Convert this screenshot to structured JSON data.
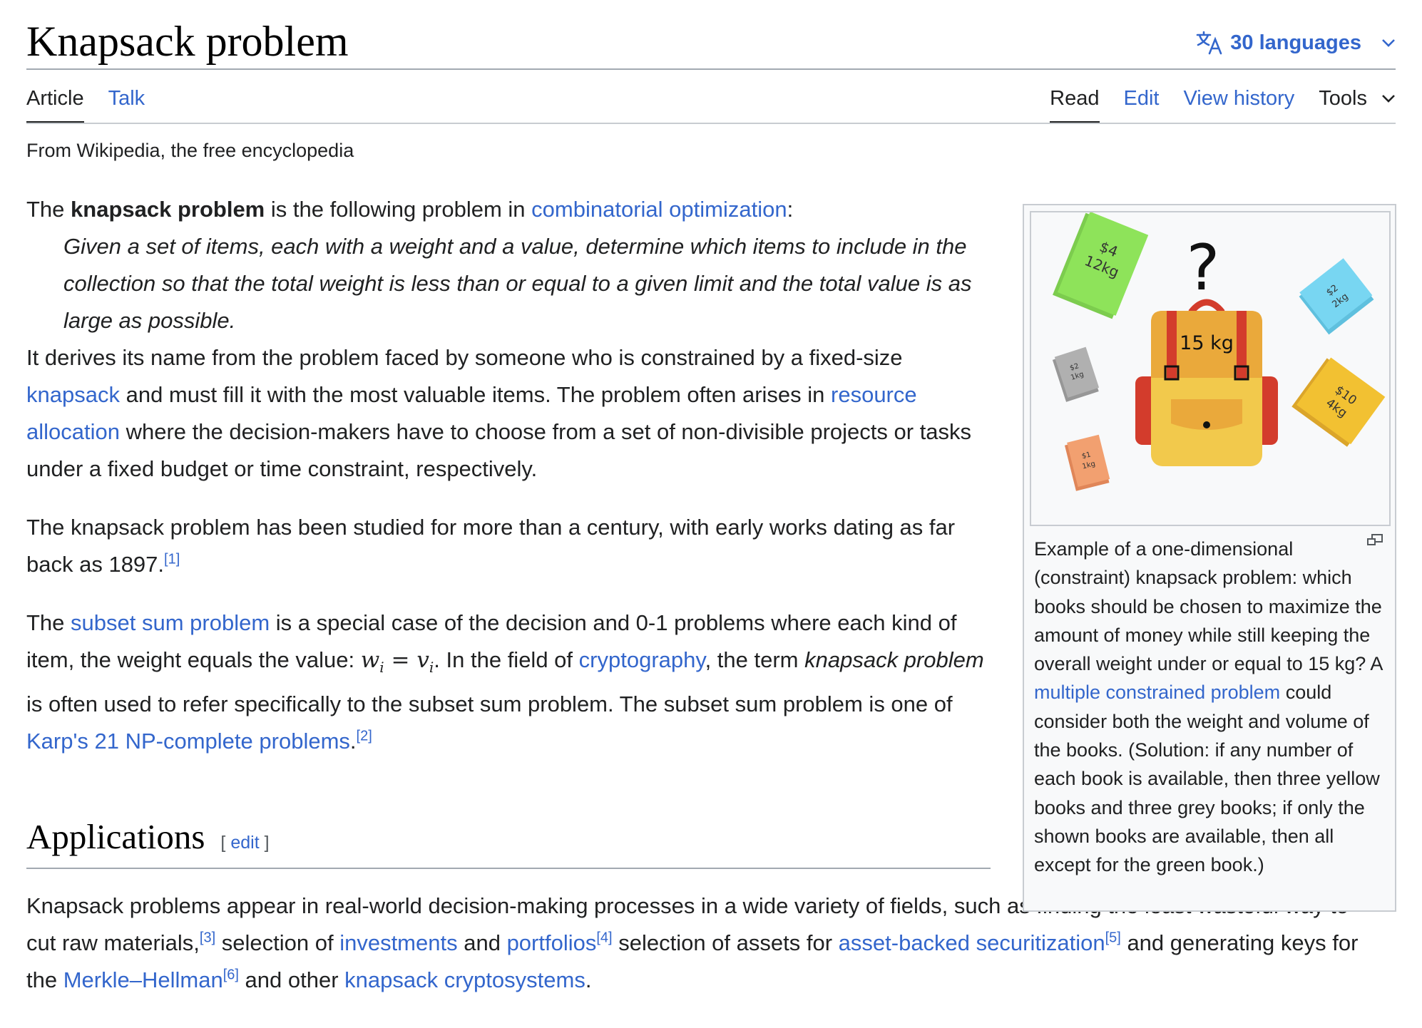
{
  "page": {
    "title": "Knapsack problem",
    "languages_label": "30 languages",
    "tagline": "From Wikipedia, the free encyclopedia"
  },
  "tabs_left": [
    {
      "label": "Article",
      "selected": true
    },
    {
      "label": "Talk",
      "selected": false
    }
  ],
  "tabs_right": [
    {
      "label": "Read",
      "selected": true
    },
    {
      "label": "Edit",
      "selected": false
    },
    {
      "label": "View history",
      "selected": false
    }
  ],
  "tools_label": "Tools",
  "intro": {
    "p1_before": "The ",
    "p1_bold": "knapsack problem",
    "p1_mid": " is the following problem in ",
    "p1_link": "combinatorial optimization",
    "p1_after": ":",
    "quote": "Given a set of items, each with a weight and a value, determine which items to include in the collection so that the total weight is less than or equal to a given limit and the total value is as large as possible.",
    "p2_a": "It derives its name from the problem faced by someone who is constrained by a fixed-size ",
    "p2_link1": "knapsack",
    "p2_b": " and must fill it with the most valuable items. The problem often arises in ",
    "p2_link2": "resource allocation",
    "p2_c": " where the decision-makers have to choose from a set of non-divisible projects or tasks under a fixed budget or time constraint, respectively.",
    "p3": "The knapsack problem has been studied for more than a century, with early works dating as far back as 1897.",
    "p3_ref": "[1]",
    "p4_a": "The ",
    "p4_link1": "subset sum problem",
    "p4_b": " is a special case of the decision and 0-1 problems where each kind of item, the weight equals the value: ",
    "p4_math_w": "w",
    "p4_math_eq": " = ",
    "p4_math_v": "v",
    "p4_math_sub": "i",
    "p4_c": ". In the field of ",
    "p4_link2": "cryptography",
    "p4_d": ", the term ",
    "p4_italic": "knapsack problem",
    "p4_e": " is often used to refer specifically to the subset sum problem. The subset sum problem is one of ",
    "p4_link3": "Karp's 21 NP-complete problems",
    "p4_f": ".",
    "p4_ref": "[2]"
  },
  "applications": {
    "heading": "Applications",
    "edit_open": "[ ",
    "edit_label": "edit",
    "edit_close": " ]",
    "t1": "Knapsack problems appear in real-world decision-making processes in a wide variety of fields, such as finding the least wasteful way to cut raw materials,",
    "ref3": "[3]",
    "t2": " selection of ",
    "link_investments": "investments",
    "t3": " and ",
    "link_portfolios": "portfolios",
    "ref4": "[4]",
    "t4": " selection of assets for ",
    "link_abs": "asset-backed securitization",
    "ref5": "[5]",
    "t5": " and generating keys for the ",
    "link_mh": "Merkle–Hellman",
    "ref6": "[6]",
    "t6": " and other ",
    "link_crypto": "knapsack cryptosystems",
    "t7": "."
  },
  "thumb": {
    "caption_a": "Example of a one-dimensional (constraint) knapsack problem: which books should be chosen to maximize the amount of money while still keeping the overall weight under or equal to 15 kg? A ",
    "caption_link": "multiple constrained problem",
    "caption_b": " could consider both the weight and volume of the books. (Solution: if any number of each book is available, then three yellow books and three grey books; if only the shown books are available, then all except for the green book.)",
    "image": {
      "question": "?",
      "bag_label": "15 kg",
      "books": [
        {
          "price": "$4",
          "weight": "12kg",
          "color": "#8ee35a"
        },
        {
          "price": "$2",
          "weight": "2kg",
          "color": "#78d6f2"
        },
        {
          "price": "$2",
          "weight": "1kg",
          "color": "#b0b0b0"
        },
        {
          "price": "$10",
          "weight": "4kg",
          "color": "#f2c132"
        },
        {
          "price": "$1",
          "weight": "1kg",
          "color": "#f2a070"
        }
      ]
    }
  },
  "colors": {
    "link": "#3366cc",
    "text": "#202122",
    "border": "#a2a9b1"
  }
}
